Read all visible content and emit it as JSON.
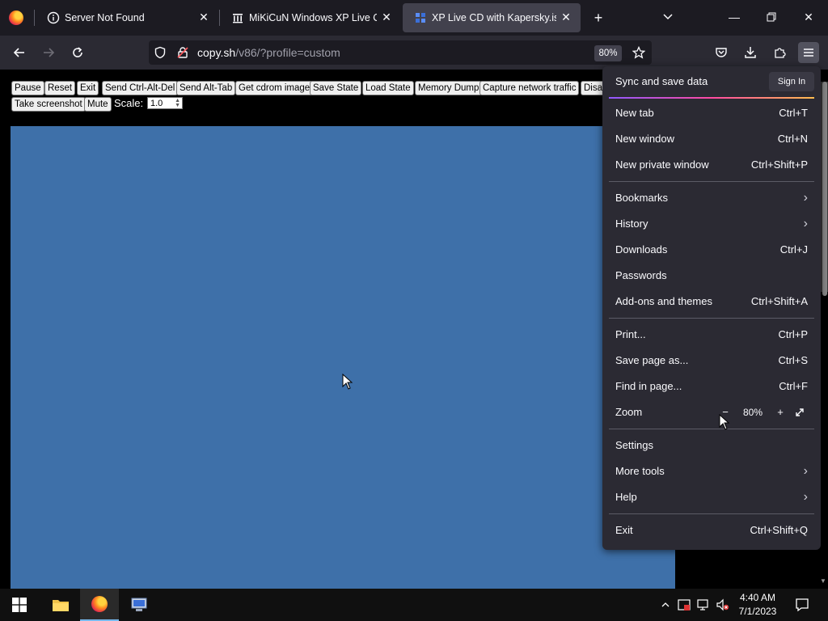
{
  "tabs": [
    {
      "title": "Server Not Found",
      "icon": "info-icon",
      "active": false
    },
    {
      "title": "MiKiCuN Windows XP Live CD",
      "icon": "archive-icon",
      "active": false
    },
    {
      "title": "XP Live CD with Kapersky.iso - V",
      "icon": "v86-icon",
      "active": true
    }
  ],
  "navbar": {
    "url_host": "copy.sh",
    "url_path": "/v86/?profile=custom",
    "zoom": "80%"
  },
  "v86": {
    "buttons_row1": [
      "Pause",
      "Reset",
      "Exit",
      "Send Ctrl-Alt-Del",
      "Send Alt-Tab",
      "Get cdrom image",
      "Save State",
      "Load State",
      "Memory Dump",
      "Capture network traffic",
      "Disa"
    ],
    "buttons_row2": [
      "Take screenshot",
      "Mute"
    ],
    "scale_label": "Scale:",
    "scale_value": "1.0",
    "screen_color": "#3e70a9"
  },
  "appmenu": {
    "sync_label": "Sync and save data",
    "sign_in": "Sign In",
    "items": [
      {
        "label": "New tab",
        "shortcut": "Ctrl+T"
      },
      {
        "label": "New window",
        "shortcut": "Ctrl+N"
      },
      {
        "label": "New private window",
        "shortcut": "Ctrl+Shift+P"
      },
      {
        "label": "Bookmarks",
        "shortcut": ""
      },
      {
        "label": "History",
        "shortcut": ""
      },
      {
        "label": "Downloads",
        "shortcut": "Ctrl+J"
      },
      {
        "label": "Passwords",
        "shortcut": ""
      },
      {
        "label": "Add-ons and themes",
        "shortcut": "Ctrl+Shift+A"
      },
      {
        "label": "Print...",
        "shortcut": "Ctrl+P"
      },
      {
        "label": "Save page as...",
        "shortcut": "Ctrl+S"
      },
      {
        "label": "Find in page...",
        "shortcut": "Ctrl+F"
      },
      {
        "label": "Zoom",
        "shortcut": ""
      },
      {
        "label": "Settings",
        "shortcut": ""
      },
      {
        "label": "More tools",
        "shortcut": ""
      },
      {
        "label": "Help",
        "shortcut": ""
      },
      {
        "label": "Exit",
        "shortcut": "Ctrl+Shift+Q"
      }
    ],
    "zoom_value": "80%",
    "zoom_minus": "−",
    "zoom_plus": "+"
  },
  "taskbar": {
    "time": "4:40 AM",
    "date": "7/1/2023",
    "apps": [
      "file-explorer-icon",
      "firefox-icon",
      "network-app-icon"
    ]
  }
}
